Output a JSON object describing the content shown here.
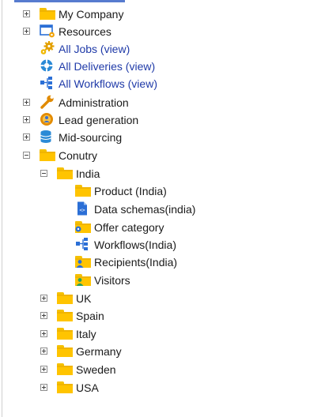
{
  "tree": {
    "items": [
      {
        "label": "My Company"
      },
      {
        "label": "Resources"
      },
      {
        "label": "All Jobs (view)"
      },
      {
        "label": "All Deliveries (view)"
      },
      {
        "label": "All Workflows (view)"
      },
      {
        "label": "Administration"
      },
      {
        "label": "Lead generation"
      },
      {
        "label": "Mid-sourcing"
      },
      {
        "label": "Conutry"
      },
      {
        "label": "India"
      },
      {
        "label": "Product (India)"
      },
      {
        "label": "Data schemas(india)"
      },
      {
        "label": "Offer category"
      },
      {
        "label": "Workflows(India)"
      },
      {
        "label": "Recipients(India)"
      },
      {
        "label": "Visitors"
      },
      {
        "label": "UK"
      },
      {
        "label": "Spain"
      },
      {
        "label": "Italy"
      },
      {
        "label": "Germany"
      },
      {
        "label": "Sweden"
      },
      {
        "label": "USA"
      }
    ]
  },
  "colors": {
    "folder": "#ffc400",
    "view_link": "#1f3aa8",
    "text": "#1a1a1a"
  }
}
